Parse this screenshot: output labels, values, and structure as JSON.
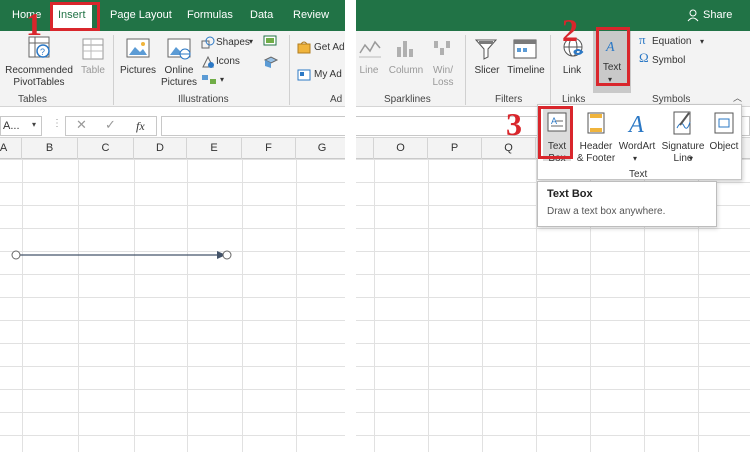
{
  "left": {
    "tabs": [
      "Home",
      "Insert",
      "Page Layout",
      "Formulas",
      "Data",
      "Review"
    ],
    "active_tab": "Insert",
    "step1": "1",
    "buttons": {
      "recommended_pivot": [
        "Recommended",
        "PivotTables"
      ],
      "table": "Table",
      "pictures": "Pictures",
      "online_pictures": [
        "Online",
        "Pictures"
      ],
      "shapes": "Shapes",
      "icons": "Icons",
      "get_addins": "Get Ad",
      "my_addins": "My Ad"
    },
    "groups": {
      "tables": "Tables",
      "illustrations": "Illustrations",
      "addins": "Ad"
    },
    "name_box": "A...",
    "fx": "fx",
    "columns": [
      "A",
      "B",
      "C",
      "D",
      "E",
      "F",
      "G"
    ]
  },
  "right": {
    "share": "Share",
    "step2": "2",
    "step3": "3",
    "buttons": {
      "line": "Line",
      "column": "Column",
      "winloss": [
        "Win/",
        "Loss"
      ],
      "slicer": "Slicer",
      "timeline": "Timeline",
      "link": "Link",
      "text": "Text",
      "equation": "Equation",
      "symbol": "Symbol"
    },
    "groups": {
      "sparklines": "Sparklines",
      "filters": "Filters",
      "links": "Links",
      "symbols": "Symbols"
    },
    "columns": [
      "O",
      "P",
      "Q"
    ],
    "dropdown": {
      "text_box": [
        "Text",
        "Box"
      ],
      "header_footer": [
        "Header",
        "& Footer"
      ],
      "wordart": "WordArt",
      "signature_line": [
        "Signature",
        "Line"
      ],
      "object": "Object",
      "group_label": "Text"
    },
    "tooltip": {
      "title": "Text Box",
      "desc": "Draw a text box anywhere."
    }
  },
  "colors": {
    "excel_green": "#217346",
    "highlight_red": "#d9262c",
    "ribbon_bg": "#f3f3f3"
  }
}
